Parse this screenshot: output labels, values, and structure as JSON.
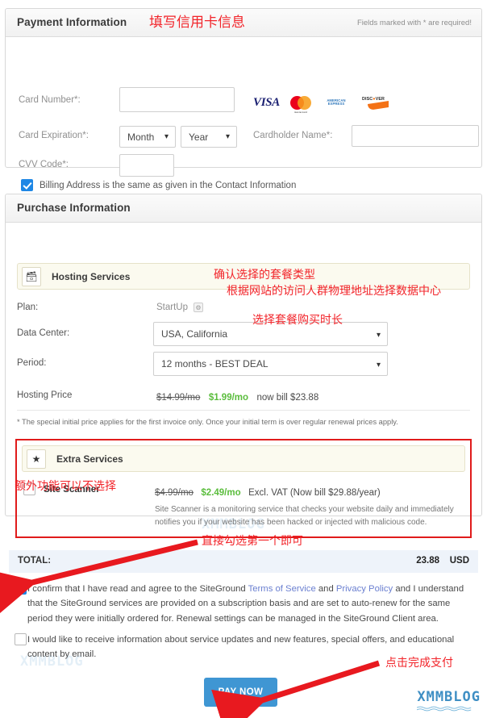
{
  "payment": {
    "title": "Payment Information",
    "annotation": "填写信用卡信息",
    "required_note": "Fields marked with * are required!",
    "fields": {
      "card_number_label": "Card Number*:",
      "card_expiration_label": "Card Expiration*:",
      "month_value": "Month",
      "year_value": "Year",
      "cardholder_label": "Cardholder Name*:",
      "cvv_label": "CVV Code*:",
      "card_number_value": "",
      "cardholder_value": "",
      "cvv_value": ""
    },
    "cards": [
      "VISA",
      "mastercard",
      "AMERICAN EXPRESS",
      "DISCOVER"
    ],
    "billing_checkbox": {
      "label": "Billing Address is the same as given in the Contact Information",
      "checked": true
    }
  },
  "purchase": {
    "title": "Purchase Information",
    "hosting": {
      "header": "Hosting Services",
      "icon": "server-icon",
      "plan_label": "Plan:",
      "plan_value": "StartUp",
      "datacenter_label": "Data Center:",
      "datacenter_value": "USA, California",
      "period_label": "Period:",
      "period_value": "12 months - BEST DEAL",
      "price_label": "Hosting Price",
      "price_old": "$14.99/mo",
      "price_new": "$1.99/mo",
      "price_rest": "now bill $23.88"
    },
    "fineprint": "* The special initial price applies for the first invoice only. Once your initial term is over regular renewal prices apply.",
    "extra": {
      "header": "Extra Services",
      "icon": "star-icon",
      "item_name": "Site Scanner",
      "checked": false,
      "price_old": "$4.99/mo",
      "price_new": "$2.49/mo",
      "price_rest": "Excl. VAT (Now bill $29.88/year)",
      "description": "Site Scanner is a monitoring service that checks your website daily and immediately notifies you if your website has been hacked or injected with malicious code."
    },
    "annotations": {
      "plan": "确认选择的套餐类型",
      "datacenter": "根据网站的访问人群物理地址选择数据中心",
      "period": "选择套餐购买时长",
      "extra": "额外功能可以不选择"
    }
  },
  "total": {
    "label": "TOTAL:",
    "amount": "23.88",
    "currency": "USD"
  },
  "terms": {
    "confirm_checked": true,
    "confirm_prefix": "I confirm that I have read and agree to the SiteGround ",
    "link_terms": "Terms of Service",
    "confirm_mid": " and ",
    "link_privacy": "Privacy Policy",
    "confirm_suffix": " and I understand that the SiteGround services are provided on a subscription basis and are set to auto-renew for the same period they were initially ordered for. Renewal settings can be managed in the SiteGround Client area.",
    "marketing_checked": false,
    "marketing_text": "I would like to receive information about service updates and new features, special offers, and educational content by email."
  },
  "pay_button": {
    "label": "PAY NOW"
  },
  "annotations": {
    "checkbox_hint": "直接勾选第一个即可",
    "pay_hint": "点击完成支付"
  },
  "watermark": {
    "text": "XMMBLOG",
    "logo": "XMMBLOG"
  },
  "colors": {
    "annotation_red": "#f2242a",
    "accent_blue": "#3f96d3",
    "price_green": "#5bbd3d",
    "link": "#6a7fd0"
  }
}
